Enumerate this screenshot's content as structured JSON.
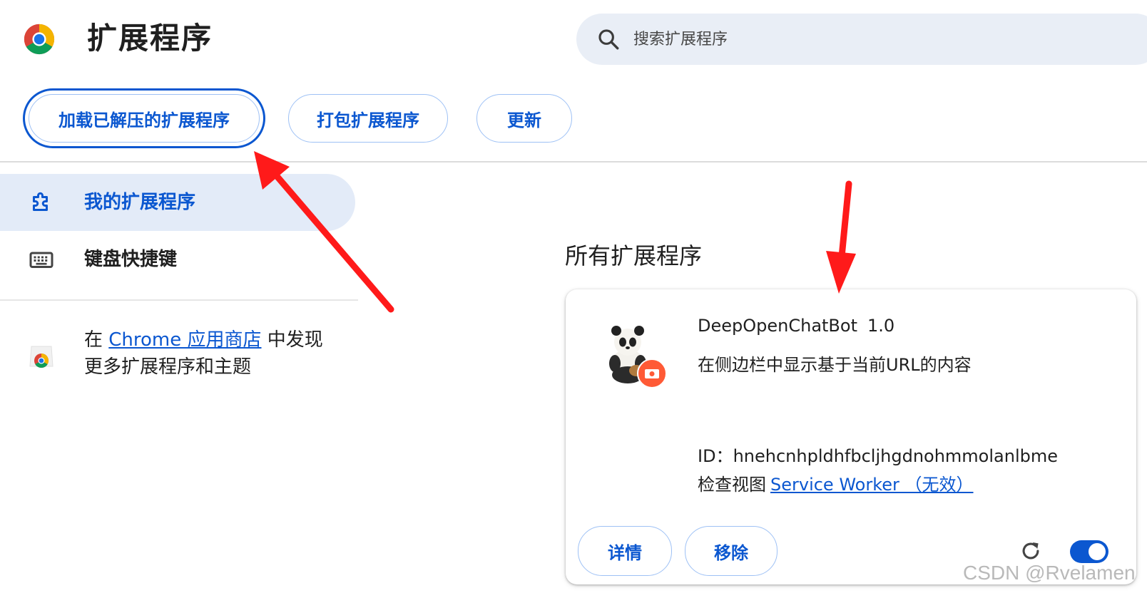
{
  "header": {
    "title": "扩展程序",
    "search_placeholder": "搜索扩展程序"
  },
  "toolbar": {
    "load_unpacked": "加载已解压的扩展程序",
    "pack": "打包扩展程序",
    "update": "更新"
  },
  "sidebar": {
    "items": [
      {
        "label": "我的扩展程序",
        "selected": true,
        "icon": "extension-puzzle-icon"
      },
      {
        "label": "键盘快捷键",
        "selected": false,
        "icon": "keyboard-icon"
      }
    ],
    "store": {
      "prefix": "在 ",
      "link": "Chrome 应用商店",
      "suffix": " 中发现更多扩展程序和主题"
    }
  },
  "main": {
    "section_title": "所有扩展程序",
    "extension": {
      "name": "DeepOpenChatBot",
      "version": "1.0",
      "description": "在侧边栏中显示基于当前URL的内容",
      "id_label": "ID：",
      "id": "hnehcnhpldhfbcljhgdnohmmolanlbme",
      "inspect_label": "检查视图",
      "inspect_link": "Service Worker （无效）",
      "details_button": "详情",
      "remove_button": "移除",
      "enabled": true
    }
  },
  "watermark": "CSDN @Rvelamen",
  "colors": {
    "accent": "#0b57d0",
    "selected_bg": "#e3ebf8",
    "search_bg": "#e9eef6",
    "annotation_arrow": "#ff1a1a"
  }
}
